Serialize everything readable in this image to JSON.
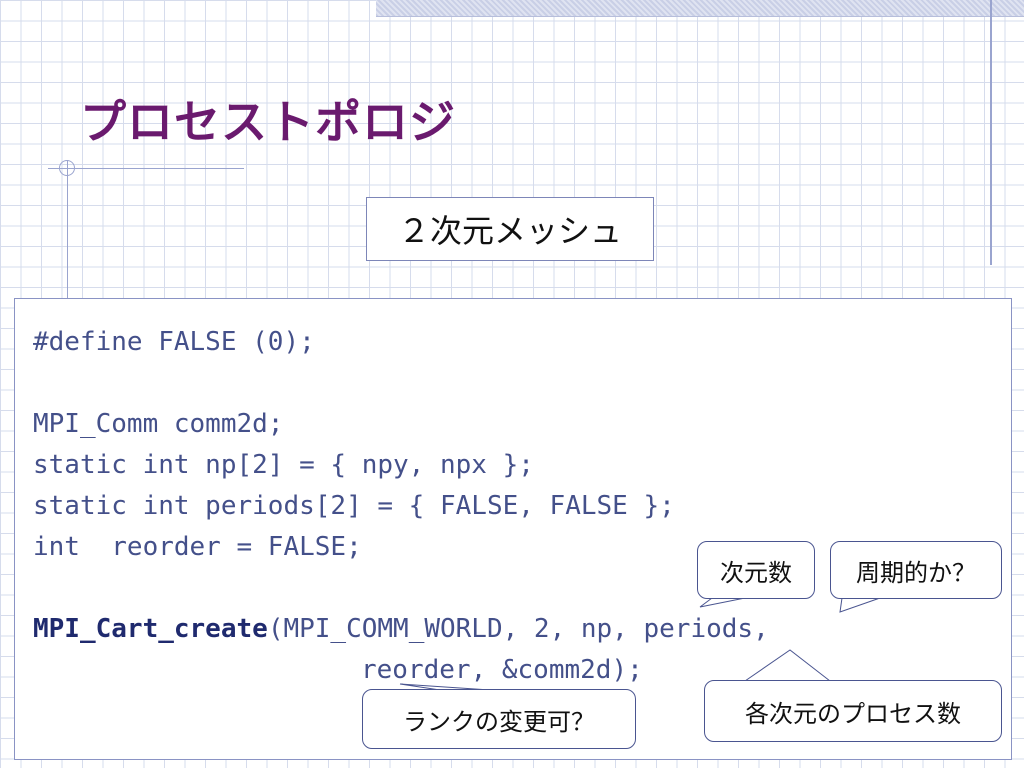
{
  "slide": {
    "title": "プロセストポロジ",
    "subtitle": "２次元メッシュ"
  },
  "code": {
    "line1": "#define FALSE (0);",
    "line2": "MPI_Comm comm2d;",
    "line3": "static int np[2] = { npy, npx };",
    "line4": "static int periods[2] = { FALSE, FALSE };",
    "line5": "int  reorder = FALSE;",
    "line6_func": "MPI_Cart_create",
    "line6_args": "(MPI_COMM_WORLD, 2, np, periods,",
    "line7": "reorder, &comm2d);"
  },
  "callouts": {
    "dims": "次元数",
    "periodic": "周期的か？",
    "procs_per_dim": "各次元のプロセス数",
    "reorder": "ランクの変更可？"
  },
  "colors": {
    "title": "#6a1a6e",
    "code_text": "#44508a",
    "grid": "#d6dcec",
    "border": "#8a93c4"
  }
}
